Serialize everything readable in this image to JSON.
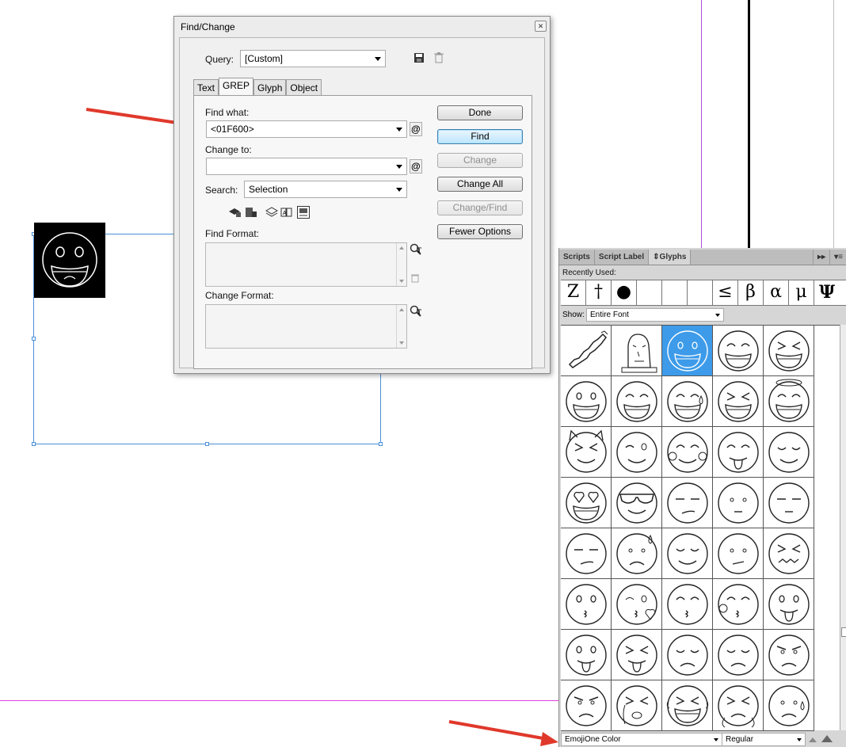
{
  "dialog": {
    "title": "Find/Change",
    "query_label": "Query:",
    "query_value": "[Custom]",
    "tabs": [
      "Text",
      "GREP",
      "Glyph",
      "Object"
    ],
    "active_tab": "GREP",
    "find_what_label": "Find what:",
    "find_what_value": "<01F600>",
    "change_to_label": "Change to:",
    "change_to_value": "",
    "search_label": "Search:",
    "search_value": "Selection",
    "find_format_label": "Find Format:",
    "change_format_label": "Change Format:",
    "buttons": {
      "done": "Done",
      "find": "Find",
      "change": "Change",
      "change_all": "Change All",
      "change_find": "Change/Find",
      "fewer_options": "Fewer Options"
    }
  },
  "glyphs_panel": {
    "tabs": [
      "Scripts",
      "Script Label",
      "⇕Glyphs"
    ],
    "active_tab": "⇕Glyphs",
    "recently_used_label": "Recently Used:",
    "recent_glyphs": [
      "Z",
      "†",
      "●",
      "",
      "",
      "",
      "≤",
      "β",
      "α",
      "μ",
      "Ψ"
    ],
    "show_label": "Show:",
    "show_value": "Entire Font",
    "font_name": "EmojiOne Color",
    "font_style": "Regular",
    "glyph_icons": [
      "map-icon",
      "statue-icon",
      "grinning-face-icon",
      "grin-icon",
      "grin-squint-icon",
      "smiley-icon",
      "smile-icon",
      "sweat-smile-icon",
      "laughing-icon",
      "halo-icon",
      "imp-icon",
      "wink-icon",
      "blush-icon",
      "yum-icon",
      "relieved-icon",
      "heart-eyes-icon",
      "sunglasses-icon",
      "smirk-icon",
      "neutral-icon",
      "expressionless-icon",
      "unamused-icon",
      "sweat-icon",
      "pensive-icon",
      "confused-icon",
      "confounded-icon",
      "kissing-icon",
      "kissing-heart-icon",
      "kissing-closed-eyes-icon",
      "kissing-blush-icon",
      "tongue-icon",
      "tongue-wink-icon",
      "tongue-closed-eyes-icon",
      "disappointed-icon",
      "worried-icon",
      "angry-icon",
      "rage-icon",
      "cry-icon",
      "joy-icon",
      "triumph-icon",
      "sad-sweat-icon"
    ]
  },
  "colors": {
    "selection_blue": "#3d9be9",
    "arrow_red": "#e0392b",
    "guide_magenta": "#e040e0"
  }
}
